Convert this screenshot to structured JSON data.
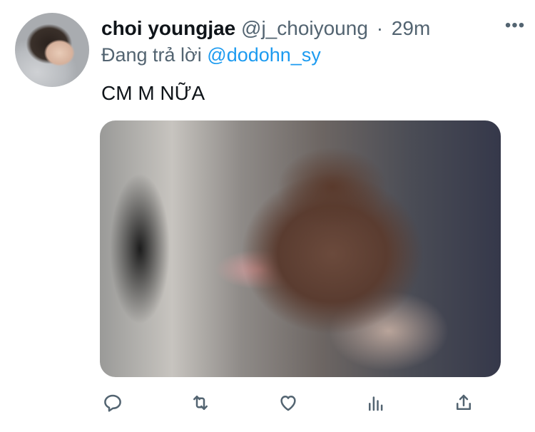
{
  "tweet": {
    "display_name": "choi youngjae",
    "handle": "@j_choiyoung",
    "separator": "·",
    "time": "29m",
    "more_label": "•••",
    "reply_prefix": "Đang trả lời",
    "reply_to": "@dodohn_sy",
    "text": "CM M NỮA"
  },
  "actions": [
    {
      "icon": "reply-icon"
    },
    {
      "icon": "retweet-icon"
    },
    {
      "icon": "like-icon"
    },
    {
      "icon": "analytics-icon"
    },
    {
      "icon": "share-icon"
    }
  ],
  "colors": {
    "text": "#0f1419",
    "muted": "#536471",
    "link": "#1d9bf0",
    "background": "#ffffff"
  }
}
